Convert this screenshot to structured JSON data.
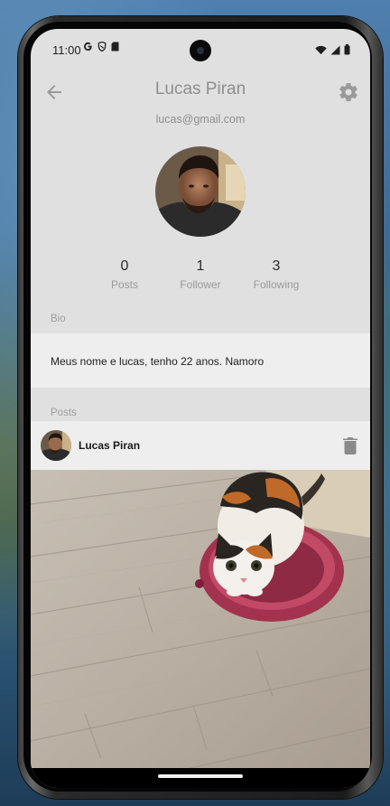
{
  "status_bar": {
    "time": "11:00",
    "left_icons": [
      "google-g-icon",
      "shield-icon",
      "sd-card-icon"
    ],
    "right_icons": [
      "wifi-icon",
      "signal-icon",
      "battery-icon"
    ]
  },
  "app_bar": {
    "title": "Lucas Piran",
    "back_icon": "arrow-back-icon",
    "settings_icon": "gear-icon"
  },
  "profile": {
    "email": "lucas@gmail.com",
    "stats": [
      {
        "value": "0",
        "label": "Posts"
      },
      {
        "value": "1",
        "label": "Follower"
      },
      {
        "value": "3",
        "label": "Following"
      }
    ]
  },
  "bio": {
    "label": "Bio",
    "text": "Meus nome e lucas, tenho 22 anos. Namoro"
  },
  "posts": {
    "label": "Posts",
    "items": [
      {
        "author": "Lucas Piran",
        "delete_icon": "trash-icon"
      }
    ]
  },
  "colors": {
    "screen_bg": "#e0e0e0",
    "card_bg": "#eeeeee",
    "title_gray": "#8e8e8e",
    "text_dark": "#222222"
  }
}
